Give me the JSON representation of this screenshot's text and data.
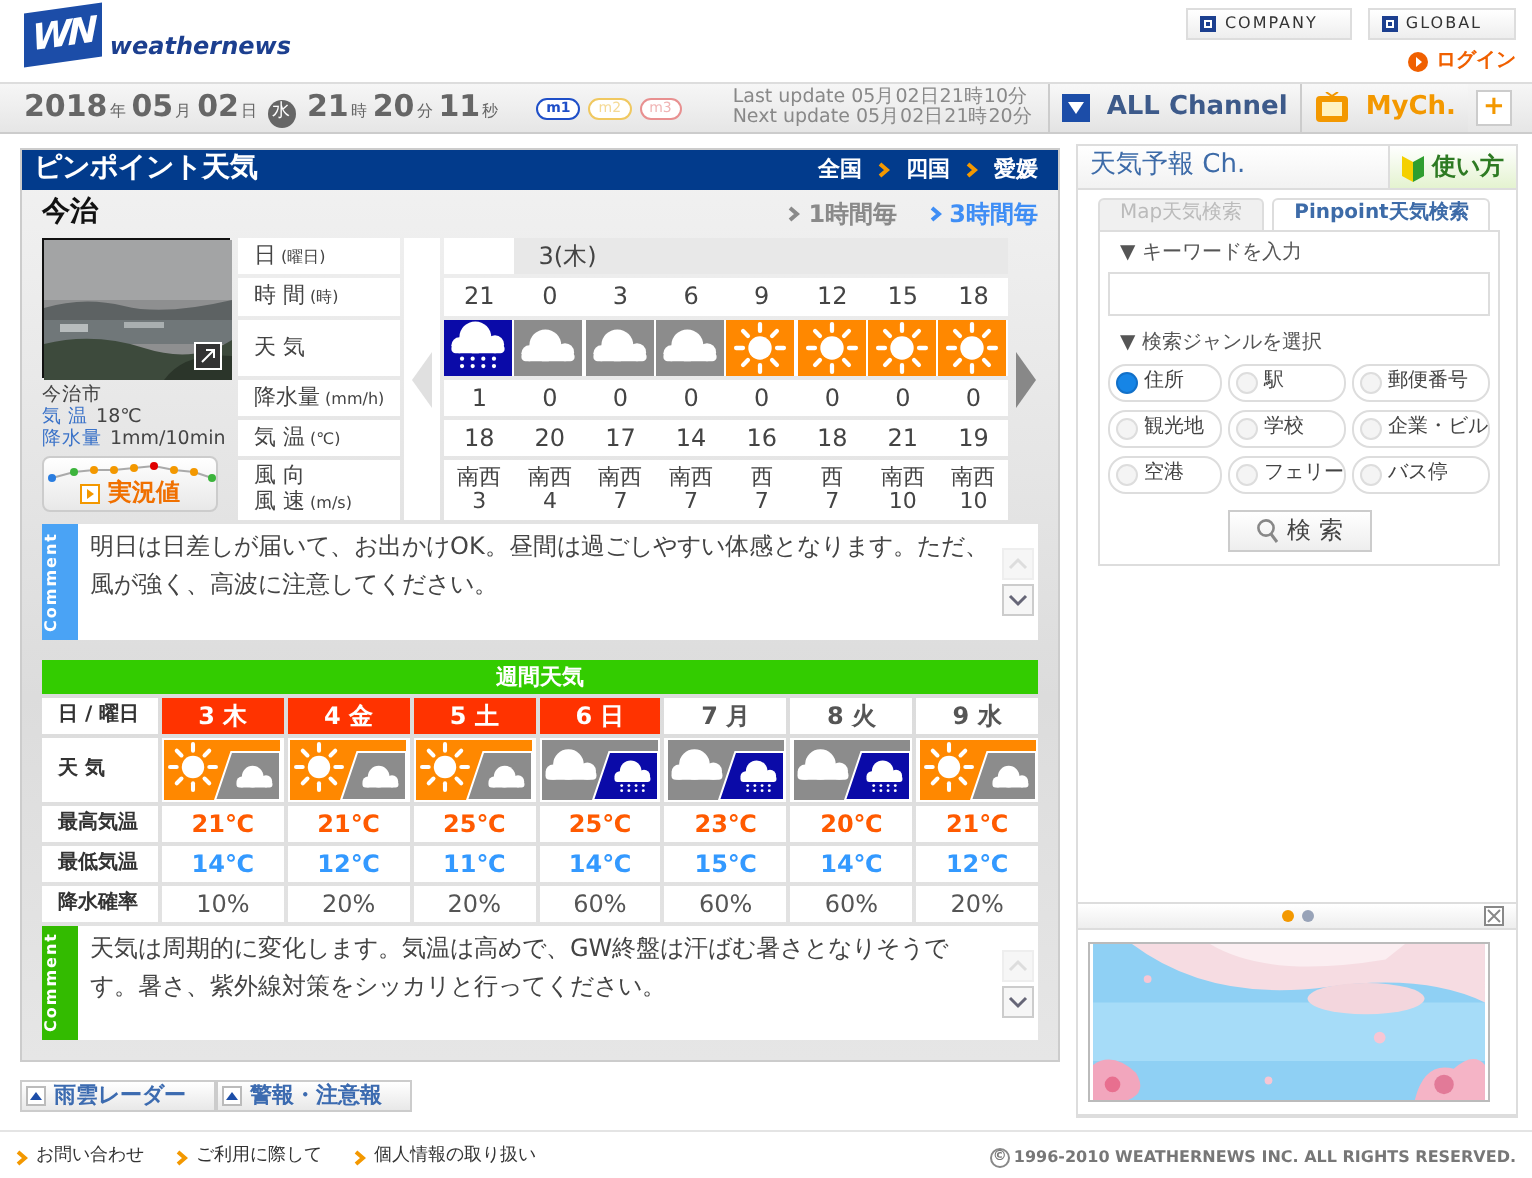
{
  "header": {
    "logo_mark": "WN",
    "logo_text": "weathernews",
    "links": [
      "COMPANY",
      "GLOBAL"
    ],
    "login": "ログイン"
  },
  "datebar": {
    "date": [
      {
        "value": "2018",
        "unit": "年"
      },
      {
        "value": "05",
        "unit": "月"
      },
      {
        "value": "02",
        "unit": "日"
      }
    ],
    "weekday": "水",
    "time": [
      {
        "value": "21",
        "unit": "時"
      },
      {
        "value": "20",
        "unit": "分"
      },
      {
        "value": "11",
        "unit": "秒"
      }
    ],
    "modes": [
      {
        "label": "m1",
        "selected": true,
        "color": "#1f4fc8"
      },
      {
        "label": "m2",
        "selected": false,
        "color": "#f0c860"
      },
      {
        "label": "m3",
        "selected": false,
        "color": "#e89090"
      }
    ],
    "updates": [
      {
        "label": "Last update",
        "value": "05月02日21時10分"
      },
      {
        "label": "Next update",
        "value": "05月02日21時20分"
      }
    ],
    "channels": [
      {
        "label": "ALL Channel",
        "kind": "all"
      },
      {
        "label": "MyCh.",
        "kind": "my"
      }
    ],
    "add": "+"
  },
  "pinpoint": {
    "title": "ピンポイント天気",
    "breadcrumb": [
      "全国",
      "四国",
      "愛媛"
    ],
    "location": "今治",
    "intervals": [
      {
        "label": "1時間毎",
        "selected": false
      },
      {
        "label": "3時間毎",
        "selected": true
      }
    ],
    "camera": {
      "kind": "picture",
      "place": "今治市",
      "readings": [
        {
          "label": "気 温",
          "value": "18℃"
        },
        {
          "label": "降水量",
          "value": "1mm/10min"
        }
      ],
      "button": "実況値"
    },
    "row_labels": [
      {
        "lines": [
          "日"
        ],
        "unit": "(曜日)"
      },
      {
        "lines": [
          "時 間"
        ],
        "unit": "(時)"
      },
      {
        "lines": [
          "天 気"
        ]
      },
      {
        "lines": [
          "降水量"
        ],
        "unit": "(mm/h)"
      },
      {
        "lines": [
          "気 温"
        ],
        "unit": "(℃)"
      },
      {
        "lines": [
          "風 向",
          "風 速"
        ],
        "unit": "(m/s)"
      }
    ],
    "hours": [
      {
        "time": "21",
        "weather": {
          "kind": "rain"
        },
        "precip": "1",
        "temp": "18",
        "wind_dir": "南西",
        "wind_speed": "3"
      },
      {
        "day": "3(木)",
        "time": "0",
        "weather": {
          "kind": "cloudy"
        },
        "precip": "0",
        "temp": "20",
        "wind_dir": "南西",
        "wind_speed": "4"
      },
      {
        "time": "3",
        "weather": {
          "kind": "cloudy"
        },
        "precip": "0",
        "temp": "17",
        "wind_dir": "南西",
        "wind_speed": "7"
      },
      {
        "time": "6",
        "weather": {
          "kind": "cloudy"
        },
        "precip": "0",
        "temp": "14",
        "wind_dir": "南西",
        "wind_speed": "7"
      },
      {
        "time": "9",
        "weather": {
          "kind": "sunny"
        },
        "precip": "0",
        "temp": "16",
        "wind_dir": "西",
        "wind_speed": "7"
      },
      {
        "time": "12",
        "weather": {
          "kind": "sunny"
        },
        "precip": "0",
        "temp": "18",
        "wind_dir": "西",
        "wind_speed": "7"
      },
      {
        "time": "15",
        "weather": {
          "kind": "sunny"
        },
        "precip": "0",
        "temp": "21",
        "wind_dir": "南西",
        "wind_speed": "10"
      },
      {
        "time": "18",
        "weather": {
          "kind": "sunny"
        },
        "precip": "0",
        "temp": "19",
        "wind_dir": "南西",
        "wind_speed": "10"
      }
    ],
    "comment": {
      "tab": "Comment",
      "text": "明日は日差しが届いて、お出かけOK。昼間は過ごしやすい体感となります。ただ、風が強く、高波に注意してください。"
    }
  },
  "weekly": {
    "title": "週間天気",
    "row_labels": [
      "日 / 曜日",
      "天 気",
      "最高気温",
      "最低気温",
      "降水確率"
    ],
    "days": [
      {
        "day": "3 木",
        "holiday": true,
        "weather": {
          "kind": "sunny"
        },
        "later": {
          "kind": "cloudy"
        },
        "high": "21℃",
        "low": "14℃",
        "pop": "10%"
      },
      {
        "day": "4 金",
        "holiday": true,
        "weather": {
          "kind": "sunny"
        },
        "later": {
          "kind": "cloudy"
        },
        "high": "21℃",
        "low": "12℃",
        "pop": "20%"
      },
      {
        "day": "5 土",
        "holiday": true,
        "weather": {
          "kind": "sunny"
        },
        "later": {
          "kind": "cloudy"
        },
        "high": "25℃",
        "low": "11℃",
        "pop": "20%"
      },
      {
        "day": "6 日",
        "holiday": true,
        "weather": {
          "kind": "cloudy"
        },
        "later": {
          "kind": "rain"
        },
        "high": "25℃",
        "low": "14℃",
        "pop": "60%"
      },
      {
        "day": "7 月",
        "holiday": false,
        "weather": {
          "kind": "cloudy"
        },
        "later": {
          "kind": "rain"
        },
        "high": "23℃",
        "low": "15℃",
        "pop": "60%"
      },
      {
        "day": "8 火",
        "holiday": false,
        "weather": {
          "kind": "cloudy"
        },
        "later": {
          "kind": "rain"
        },
        "high": "20℃",
        "low": "14℃",
        "pop": "60%"
      },
      {
        "day": "9 水",
        "holiday": false,
        "weather": {
          "kind": "sunny"
        },
        "later": {
          "kind": "cloudy"
        },
        "high": "21℃",
        "low": "12℃",
        "pop": "20%"
      }
    ],
    "comment": {
      "tab": "Comment",
      "text": "天気は周期的に変化します。気温は高めで、GW終盤は汗ばむ暑さとなりそうです。暑さ、紫外線対策をシッカリと行ってください。"
    }
  },
  "bottom_tabs": [
    "雨雲レーダー",
    "警報・注意報"
  ],
  "sidebar": {
    "title": "天気予報 Ch.",
    "help": "使い方",
    "tabs": [
      {
        "label": "Map天気検索",
        "selected": false
      },
      {
        "label": "Pinpoint天気検索",
        "selected": true
      }
    ],
    "keyword_label": "▼ キーワードを入力",
    "genre_label": "▼ 検索ジャンルを選択",
    "genres": [
      {
        "label": "住所",
        "selected": true
      },
      {
        "label": "駅",
        "selected": false
      },
      {
        "label": "郵便番号",
        "selected": false
      },
      {
        "label": "観光地",
        "selected": false
      },
      {
        "label": "学校",
        "selected": false
      },
      {
        "label": "企業・ビル",
        "selected": false
      },
      {
        "label": "空港",
        "selected": false
      },
      {
        "label": "フェリー",
        "selected": false
      },
      {
        "label": "バス停",
        "selected": false
      }
    ],
    "search_button": "検 索",
    "pager": [
      {
        "selected": true
      },
      {
        "selected": false
      }
    ]
  },
  "footer": {
    "links": [
      "お問い合わせ",
      "ご利用に際して",
      "個人情報の取り扱い"
    ],
    "copyright_mark": "©",
    "copyright": "1996-2010 WEATHERNEWS INC. ALL RIGHTS RESERVED."
  }
}
